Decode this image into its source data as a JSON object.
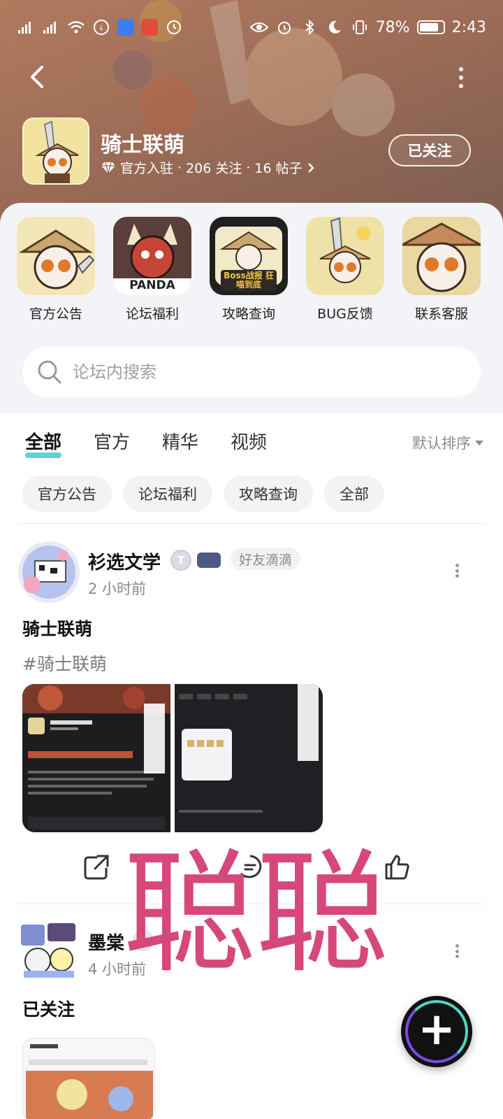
{
  "status_bar": {
    "battery": "78%",
    "time": "2:43"
  },
  "forum": {
    "name": "骑士联萌",
    "meta_official": "官方入驻",
    "meta_follow": "206 关注",
    "meta_posts": "16 帖子",
    "follow_label": "已关注"
  },
  "shortcuts": [
    {
      "label": "官方公告"
    },
    {
      "label": "论坛福利",
      "icon_text": "PANDA"
    },
    {
      "label": "攻略查询",
      "icon_text": "Boss战报 狂喵到底"
    },
    {
      "label": "BUG反馈"
    },
    {
      "label": "联系客服"
    }
  ],
  "search": {
    "placeholder": "论坛内搜索"
  },
  "tabs": [
    {
      "label": "全部",
      "active": true
    },
    {
      "label": "官方"
    },
    {
      "label": "精华"
    },
    {
      "label": "视频"
    }
  ],
  "sort_label": "默认排序",
  "chips": [
    "官方公告",
    "论坛福利",
    "攻略查询",
    "全部"
  ],
  "posts": [
    {
      "author": "衫选文学",
      "level": "T",
      "tag": "好友滴滴",
      "time": "2 小时前",
      "title": "骑士联萌",
      "topic": "#骑士联萌"
    },
    {
      "author": "墨棠",
      "time": "4 小时前",
      "title": "已关注"
    }
  ],
  "watermark": "聪聪",
  "colors": {
    "accent": "#5ed3cf",
    "watermark": "#d6477b",
    "banner": "#a06e58"
  }
}
